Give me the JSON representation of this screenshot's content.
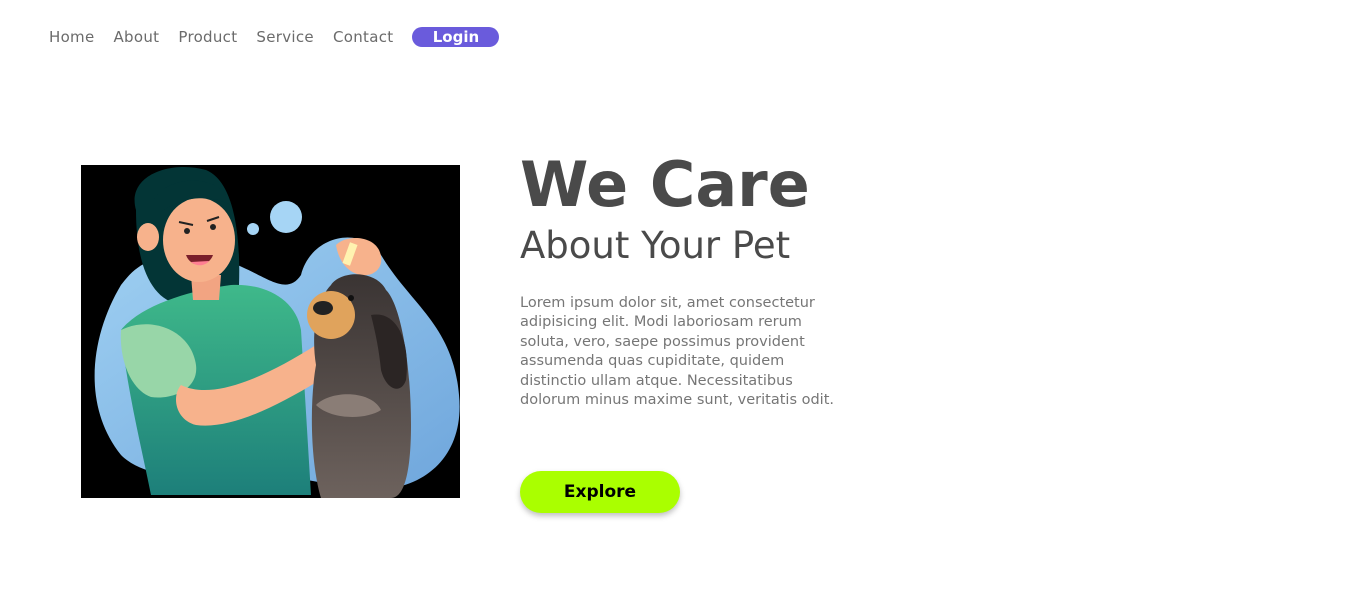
{
  "nav": {
    "items": [
      {
        "label": "Home"
      },
      {
        "label": "About"
      },
      {
        "label": "Product"
      },
      {
        "label": "Service"
      },
      {
        "label": "Contact"
      }
    ],
    "login_label": "Login"
  },
  "hero": {
    "title": "We Care",
    "subtitle": "About Your Pet",
    "body": "Lorem ipsum dolor sit, amet consectetur adipisicing elit. Modi laboriosam rerum soluta, vero, saepe possimus provident assumenda quas cupiditate, quidem distinctio ullam atque. Necessitatibus dolorum minus maxime sunt, veritatis odit.",
    "cta_label": "Explore"
  },
  "colors": {
    "login_button": "#6a5bdc",
    "explore_button": "#aaff00",
    "heading_text": "#4a4a4a",
    "body_text": "#767676",
    "nav_text": "#6b6b6b"
  },
  "illustration": {
    "icon": "woman-with-dog-vet-illustration"
  }
}
